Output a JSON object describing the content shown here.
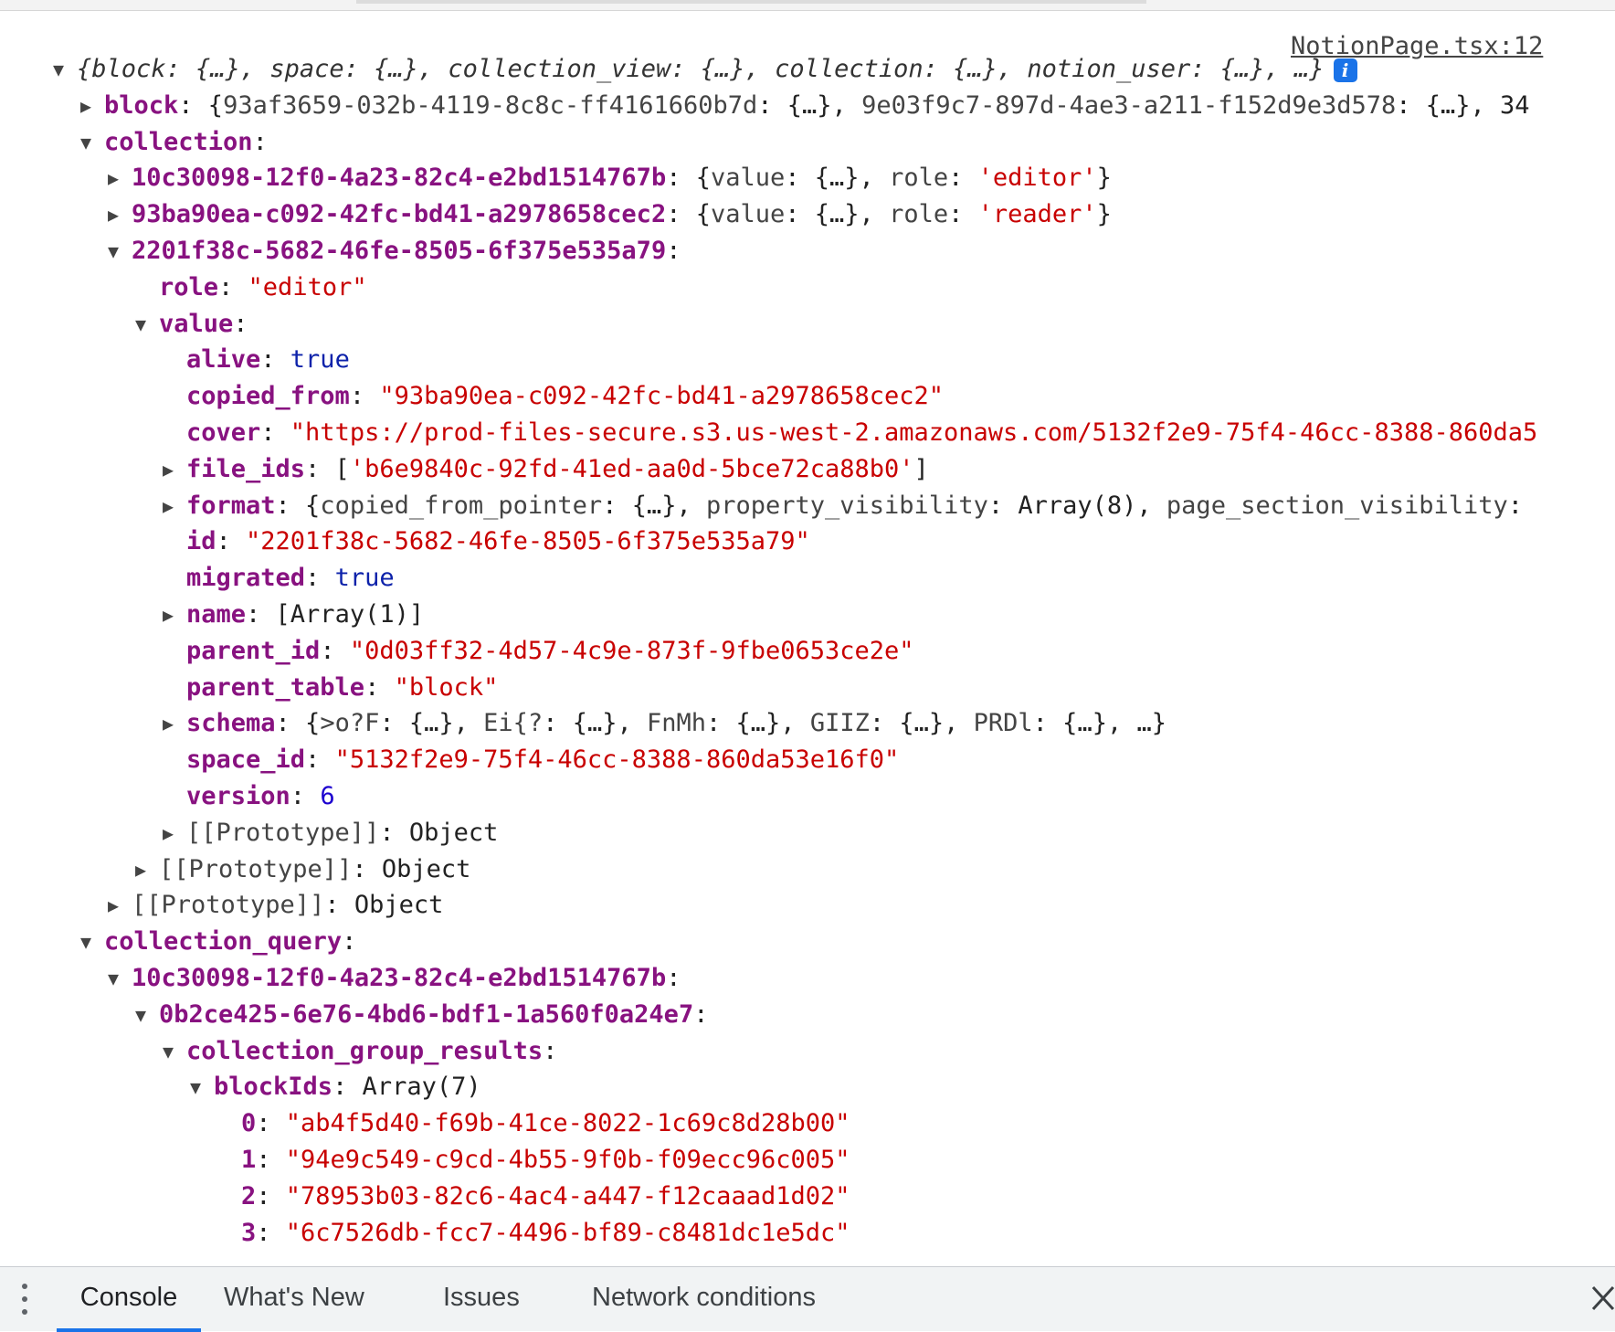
{
  "source_link": "NotionPage.tsx:12",
  "lines": [
    {
      "indent": 0,
      "tri": "open",
      "segs": [
        {
          "t": "{",
          "c": "it"
        },
        {
          "t": "block",
          "c": "it"
        },
        {
          "t": ": {…}, ",
          "c": "it"
        },
        {
          "t": "space",
          "c": "it"
        },
        {
          "t": ": {…}, ",
          "c": "it"
        },
        {
          "t": "collection_view",
          "c": "it"
        },
        {
          "t": ": {…}, ",
          "c": "it"
        },
        {
          "t": "collection",
          "c": "it"
        },
        {
          "t": ": {…}, ",
          "c": "it"
        },
        {
          "t": "notion_user",
          "c": "it"
        },
        {
          "t": ": {…}, …}",
          "c": "it"
        }
      ],
      "badge": "i"
    },
    {
      "indent": 1,
      "tri": "closed",
      "segs": [
        {
          "t": "block",
          "c": "k"
        },
        {
          "t": ": {",
          "c": "ob"
        },
        {
          "t": "93af3659-032b-4119-8c8c-ff4161660b7d",
          "c": "dim"
        },
        {
          "t": ": {…}, ",
          "c": "ob"
        },
        {
          "t": "9e03f9c7-897d-4ae3-a211-f152d9e3d578",
          "c": "dim"
        },
        {
          "t": ": {…}, 34",
          "c": "ob"
        }
      ]
    },
    {
      "indent": 1,
      "tri": "open",
      "segs": [
        {
          "t": "collection",
          "c": "k"
        },
        {
          "t": ":",
          "c": "ob"
        }
      ]
    },
    {
      "indent": 2,
      "tri": "closed",
      "segs": [
        {
          "t": "10c30098-12f0-4a23-82c4-e2bd1514767b",
          "c": "k"
        },
        {
          "t": ": {",
          "c": "ob"
        },
        {
          "t": "value",
          "c": "dim"
        },
        {
          "t": ": {…}, ",
          "c": "ob"
        },
        {
          "t": "role",
          "c": "dim"
        },
        {
          "t": ": ",
          "c": "ob"
        },
        {
          "t": "'editor'",
          "c": "s"
        },
        {
          "t": "}",
          "c": "ob"
        }
      ]
    },
    {
      "indent": 2,
      "tri": "closed",
      "segs": [
        {
          "t": "93ba90ea-c092-42fc-bd41-a2978658cec2",
          "c": "k"
        },
        {
          "t": ": {",
          "c": "ob"
        },
        {
          "t": "value",
          "c": "dim"
        },
        {
          "t": ": {…}, ",
          "c": "ob"
        },
        {
          "t": "role",
          "c": "dim"
        },
        {
          "t": ": ",
          "c": "ob"
        },
        {
          "t": "'reader'",
          "c": "s"
        },
        {
          "t": "}",
          "c": "ob"
        }
      ]
    },
    {
      "indent": 2,
      "tri": "open",
      "segs": [
        {
          "t": "2201f38c-5682-46fe-8505-6f375e535a79",
          "c": "k"
        },
        {
          "t": ":",
          "c": "ob"
        }
      ]
    },
    {
      "indent": 3,
      "tri": "none",
      "segs": [
        {
          "t": "role",
          "c": "k"
        },
        {
          "t": ": ",
          "c": "ob"
        },
        {
          "t": "\"editor\"",
          "c": "s"
        }
      ]
    },
    {
      "indent": 3,
      "tri": "open",
      "segs": [
        {
          "t": "value",
          "c": "k"
        },
        {
          "t": ":",
          "c": "ob"
        }
      ]
    },
    {
      "indent": 4,
      "tri": "none",
      "segs": [
        {
          "t": "alive",
          "c": "k"
        },
        {
          "t": ": ",
          "c": "ob"
        },
        {
          "t": "true",
          "c": "b"
        }
      ]
    },
    {
      "indent": 4,
      "tri": "none",
      "segs": [
        {
          "t": "copied_from",
          "c": "k"
        },
        {
          "t": ": ",
          "c": "ob"
        },
        {
          "t": "\"93ba90ea-c092-42fc-bd41-a2978658cec2\"",
          "c": "s"
        }
      ]
    },
    {
      "indent": 4,
      "tri": "none",
      "segs": [
        {
          "t": "cover",
          "c": "k"
        },
        {
          "t": ": ",
          "c": "ob"
        },
        {
          "t": "\"https://prod-files-secure.s3.us-west-2.amazonaws.com/5132f2e9-75f4-46cc-8388-860da5",
          "c": "s"
        }
      ]
    },
    {
      "indent": 4,
      "tri": "closed",
      "segs": [
        {
          "t": "file_ids",
          "c": "k"
        },
        {
          "t": ": [",
          "c": "ob"
        },
        {
          "t": "'b6e9840c-92fd-41ed-aa0d-5bce72ca88b0'",
          "c": "s"
        },
        {
          "t": "]",
          "c": "ob"
        }
      ]
    },
    {
      "indent": 4,
      "tri": "closed",
      "segs": [
        {
          "t": "format",
          "c": "k"
        },
        {
          "t": ": {",
          "c": "ob"
        },
        {
          "t": "copied_from_pointer",
          "c": "dim"
        },
        {
          "t": ": {…}, ",
          "c": "ob"
        },
        {
          "t": "property_visibility",
          "c": "dim"
        },
        {
          "t": ": Array(8), ",
          "c": "ob"
        },
        {
          "t": "page_section_visibility",
          "c": "dim"
        },
        {
          "t": ":",
          "c": "ob"
        }
      ]
    },
    {
      "indent": 4,
      "tri": "none",
      "segs": [
        {
          "t": "id",
          "c": "k"
        },
        {
          "t": ": ",
          "c": "ob"
        },
        {
          "t": "\"2201f38c-5682-46fe-8505-6f375e535a79\"",
          "c": "s"
        }
      ]
    },
    {
      "indent": 4,
      "tri": "none",
      "segs": [
        {
          "t": "migrated",
          "c": "k"
        },
        {
          "t": ": ",
          "c": "ob"
        },
        {
          "t": "true",
          "c": "b"
        }
      ]
    },
    {
      "indent": 4,
      "tri": "closed",
      "segs": [
        {
          "t": "name",
          "c": "k"
        },
        {
          "t": ": [Array(1)]",
          "c": "ob"
        }
      ]
    },
    {
      "indent": 4,
      "tri": "none",
      "segs": [
        {
          "t": "parent_id",
          "c": "k"
        },
        {
          "t": ": ",
          "c": "ob"
        },
        {
          "t": "\"0d03ff32-4d57-4c9e-873f-9fbe0653ce2e\"",
          "c": "s"
        }
      ]
    },
    {
      "indent": 4,
      "tri": "none",
      "segs": [
        {
          "t": "parent_table",
          "c": "k"
        },
        {
          "t": ": ",
          "c": "ob"
        },
        {
          "t": "\"block\"",
          "c": "s"
        }
      ]
    },
    {
      "indent": 4,
      "tri": "closed",
      "segs": [
        {
          "t": "schema",
          "c": "k"
        },
        {
          "t": ": {",
          "c": "ob"
        },
        {
          "t": ">o?F",
          "c": "dim"
        },
        {
          "t": ": {…}, ",
          "c": "ob"
        },
        {
          "t": "Ei{?",
          "c": "dim"
        },
        {
          "t": ": {…}, ",
          "c": "ob"
        },
        {
          "t": "FnMh",
          "c": "dim"
        },
        {
          "t": ": {…}, ",
          "c": "ob"
        },
        {
          "t": "GIIZ",
          "c": "dim"
        },
        {
          "t": ": {…}, ",
          "c": "ob"
        },
        {
          "t": "PRDl",
          "c": "dim"
        },
        {
          "t": ": {…}, …}",
          "c": "ob"
        }
      ]
    },
    {
      "indent": 4,
      "tri": "none",
      "segs": [
        {
          "t": "space_id",
          "c": "k"
        },
        {
          "t": ": ",
          "c": "ob"
        },
        {
          "t": "\"5132f2e9-75f4-46cc-8388-860da53e16f0\"",
          "c": "s"
        }
      ]
    },
    {
      "indent": 4,
      "tri": "none",
      "segs": [
        {
          "t": "version",
          "c": "k"
        },
        {
          "t": ": ",
          "c": "ob"
        },
        {
          "t": "6",
          "c": "n"
        }
      ]
    },
    {
      "indent": 4,
      "tri": "closed",
      "segs": [
        {
          "t": "[[Prototype]]",
          "c": "dim"
        },
        {
          "t": ": Object",
          "c": "ob"
        }
      ]
    },
    {
      "indent": 3,
      "tri": "closed",
      "segs": [
        {
          "t": "[[Prototype]]",
          "c": "dim"
        },
        {
          "t": ": Object",
          "c": "ob"
        }
      ]
    },
    {
      "indent": 2,
      "tri": "closed",
      "segs": [
        {
          "t": "[[Prototype]]",
          "c": "dim"
        },
        {
          "t": ": Object",
          "c": "ob"
        }
      ]
    },
    {
      "indent": 1,
      "tri": "open",
      "segs": [
        {
          "t": "collection_query",
          "c": "k"
        },
        {
          "t": ":",
          "c": "ob"
        }
      ]
    },
    {
      "indent": 2,
      "tri": "open",
      "segs": [
        {
          "t": "10c30098-12f0-4a23-82c4-e2bd1514767b",
          "c": "k"
        },
        {
          "t": ":",
          "c": "ob"
        }
      ]
    },
    {
      "indent": 3,
      "tri": "open",
      "segs": [
        {
          "t": "0b2ce425-6e76-4bd6-bdf1-1a560f0a24e7",
          "c": "k"
        },
        {
          "t": ":",
          "c": "ob"
        }
      ]
    },
    {
      "indent": 4,
      "tri": "open",
      "segs": [
        {
          "t": "collection_group_results",
          "c": "k"
        },
        {
          "t": ":",
          "c": "ob"
        }
      ]
    },
    {
      "indent": 5,
      "tri": "open",
      "segs": [
        {
          "t": "blockIds",
          "c": "k"
        },
        {
          "t": ": Array(7)",
          "c": "ob"
        }
      ]
    },
    {
      "indent": 6,
      "tri": "none",
      "segs": [
        {
          "t": "0",
          "c": "k"
        },
        {
          "t": ": ",
          "c": "ob"
        },
        {
          "t": "\"ab4f5d40-f69b-41ce-8022-1c69c8d28b00\"",
          "c": "s"
        }
      ]
    },
    {
      "indent": 6,
      "tri": "none",
      "segs": [
        {
          "t": "1",
          "c": "k"
        },
        {
          "t": ": ",
          "c": "ob"
        },
        {
          "t": "\"94e9c549-c9cd-4b55-9f0b-f09ecc96c005\"",
          "c": "s"
        }
      ]
    },
    {
      "indent": 6,
      "tri": "none",
      "segs": [
        {
          "t": "2",
          "c": "k"
        },
        {
          "t": ": ",
          "c": "ob"
        },
        {
          "t": "\"78953b03-82c6-4ac4-a447-f12caaad1d02\"",
          "c": "s"
        }
      ]
    },
    {
      "indent": 6,
      "tri": "none",
      "segs": [
        {
          "t": "3",
          "c": "k"
        },
        {
          "t": ": ",
          "c": "ob"
        },
        {
          "t": "\"6c7526db-fcc7-4496-bf89-c8481dc1e5dc\"",
          "c": "s"
        }
      ]
    }
  ],
  "drawer": {
    "tabs": [
      {
        "label": "Console",
        "active": true
      },
      {
        "label": "What's New",
        "active": false
      },
      {
        "label": "Issues",
        "active": false
      },
      {
        "label": "Network conditions",
        "active": false
      }
    ]
  },
  "colors": {
    "key": "#881280",
    "string": "#c80000",
    "boolean": "#0d22aa",
    "number": "#1c00cf",
    "accent": "#1a73e8"
  },
  "icons": {
    "open_triangle": "triangle-down-icon",
    "closed_triangle": "triangle-right-icon",
    "info_badge": "info-icon",
    "menu": "kebab-menu-icon",
    "close": "close-icon"
  }
}
